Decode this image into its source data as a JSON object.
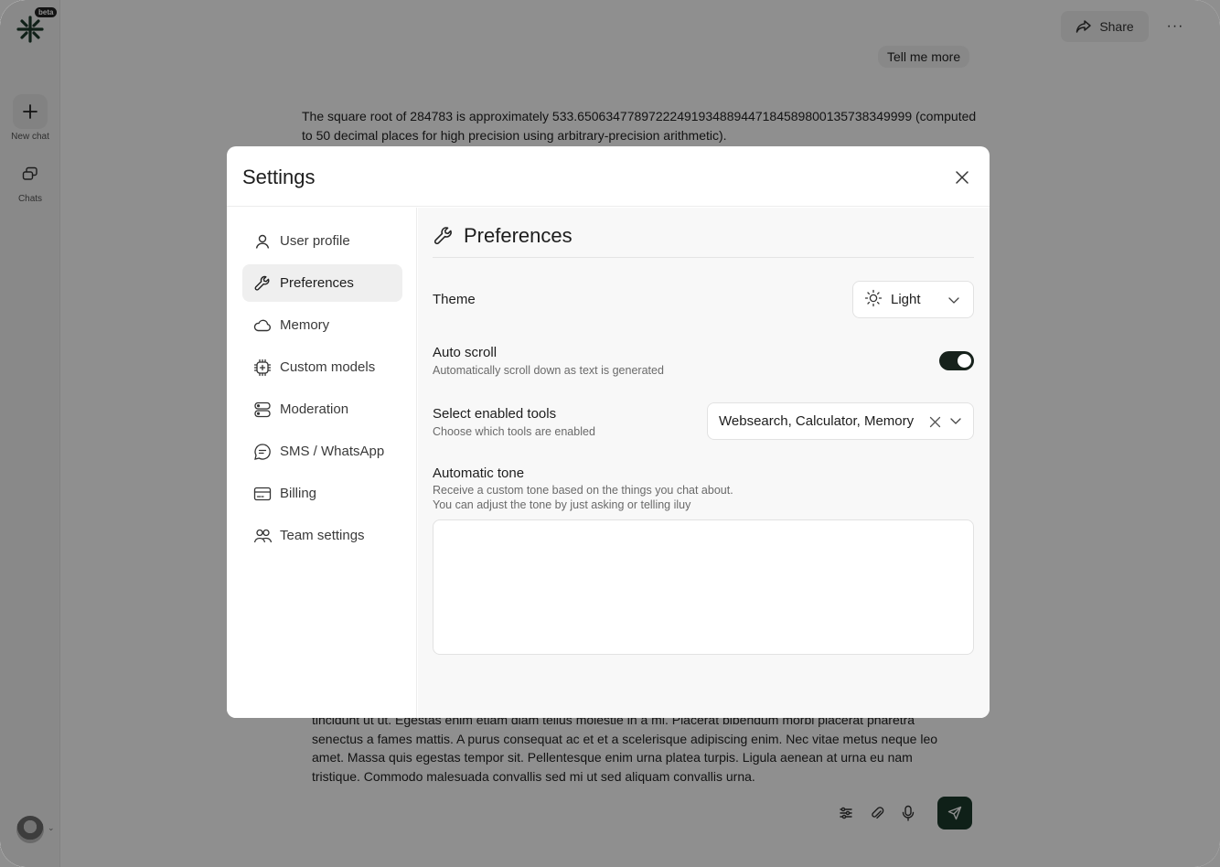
{
  "rail": {
    "beta": "beta",
    "new_chat_label": "New chat",
    "chats_label": "Chats"
  },
  "topbar": {
    "share_label": "Share",
    "more_label": "···"
  },
  "conversation": {
    "user_message": "Tell me more",
    "assistant_message": "The square root of 284783 is approximately 533.65063477897222491934889447184589800135738349999 (computed to 50 decimal places for high precision using arbitrary-precision arithmetic)."
  },
  "composer": {
    "text": "tincidunt ut ut. Egestas enim etiam diam tellus molestie in a mi. Placerat bibendum morbi placerat pharetra senectus a fames mattis. A purus consequat ac et et a scelerisque adipiscing enim. Nec vitae metus neque leo amet. Massa quis egestas tempor sit. Pellentesque enim urna platea turpis. Ligula aenean at urna eu nam tristique. Commodo malesuada convallis sed mi ut sed aliquam convallis urna."
  },
  "settings": {
    "title": "Settings",
    "nav": [
      {
        "label": "User profile",
        "icon": "user-icon"
      },
      {
        "label": "Preferences",
        "icon": "wrench-icon"
      },
      {
        "label": "Memory",
        "icon": "cloud-icon"
      },
      {
        "label": "Custom models",
        "icon": "cpu-icon"
      },
      {
        "label": "Moderation",
        "icon": "server-icon"
      },
      {
        "label": "SMS / WhatsApp",
        "icon": "message-icon"
      },
      {
        "label": "Billing",
        "icon": "credit-card-icon"
      },
      {
        "label": "Team settings",
        "icon": "users-icon"
      }
    ],
    "active_nav": "Preferences",
    "section_title": "Preferences",
    "theme": {
      "label": "Theme",
      "value": "Light"
    },
    "auto_scroll": {
      "label": "Auto scroll",
      "description": "Automatically scroll down as text is generated",
      "enabled": true
    },
    "tools": {
      "label": "Select enabled tools",
      "description": "Choose which tools are enabled",
      "value": "Websearch, Calculator, Memory"
    },
    "tone": {
      "label": "Automatic tone",
      "description_line1": "Receive a custom tone based on the things you chat about.",
      "description_line2": "You can adjust the tone by just asking or telling iluy",
      "value": ""
    }
  },
  "colors": {
    "accent": "#1c3a2c",
    "toggle_on": "#17221c",
    "overlay": "rgba(0,0,0,0.44)"
  }
}
